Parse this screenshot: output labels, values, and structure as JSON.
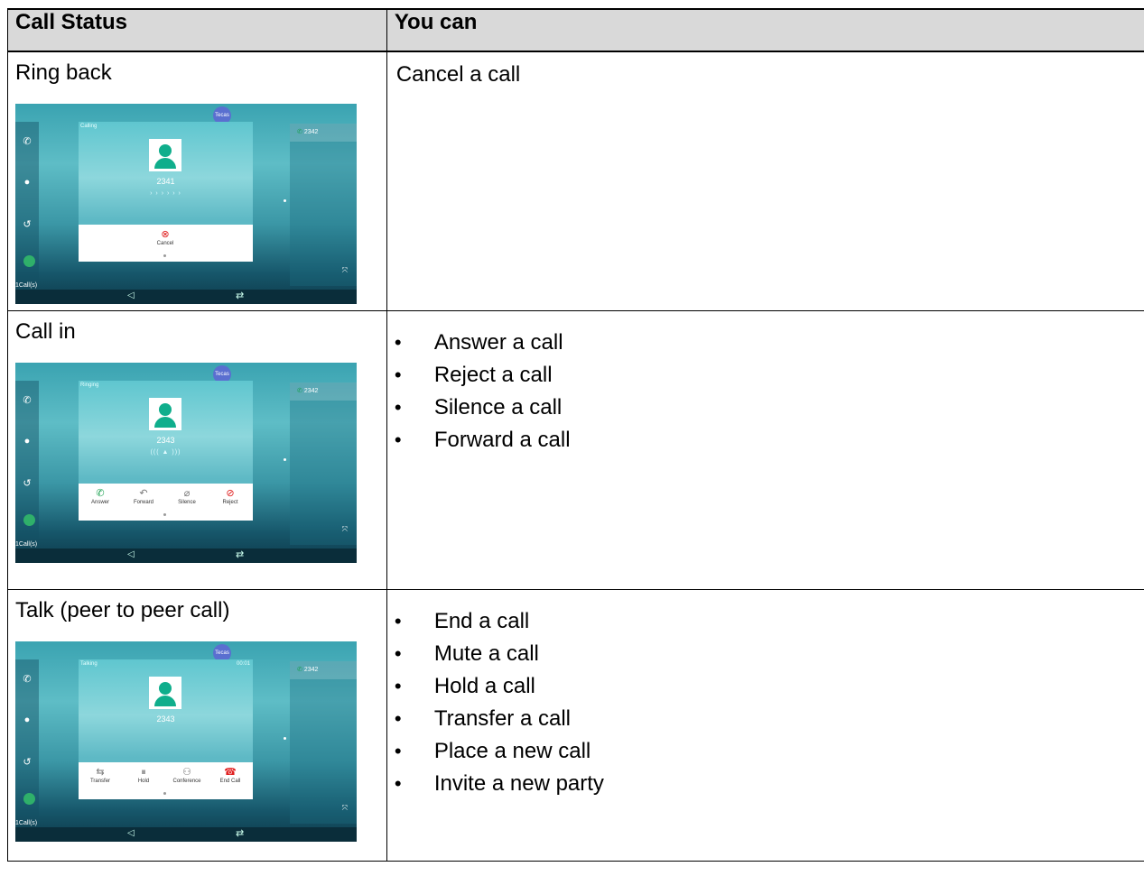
{
  "header": {
    "col1": "Call Status",
    "col2": "You can"
  },
  "rows": [
    {
      "status": "Ring back",
      "action": "Cancel a call",
      "phone": {
        "avatar": "Tecas",
        "state": "Calling",
        "time": "",
        "number": "2341",
        "anim": "› › › › › ›",
        "right_entry": "2342",
        "calls": "1Call(s)",
        "softkeys": [
          {
            "label": "Cancel",
            "icon": "cancel-icon"
          }
        ]
      }
    },
    {
      "status": "Call in",
      "actions": [
        "Answer a call",
        "Reject a call",
        "Silence a call",
        "Forward a call"
      ],
      "phone": {
        "avatar": "Tecas",
        "state": "Ringing",
        "time": "",
        "number": "2343",
        "anim": "((( ▲ )))",
        "right_entry": "2342",
        "calls": "1Call(s)",
        "softkeys": [
          {
            "label": "Answer",
            "icon": "answer-icon"
          },
          {
            "label": "Forward",
            "icon": "forward-icon"
          },
          {
            "label": "Silence",
            "icon": "silence-icon"
          },
          {
            "label": "Reject",
            "icon": "reject-icon"
          }
        ]
      }
    },
    {
      "status": "Talk (peer to peer call)",
      "actions": [
        "End a call",
        "Mute a call",
        "Hold a call",
        "Transfer a call",
        "Place a new call",
        "Invite a new party"
      ],
      "phone": {
        "avatar": "Tecas",
        "state": "Talking",
        "time": "00:01",
        "number": "2343",
        "anim": "",
        "right_entry": "2342",
        "calls": "1Call(s)",
        "softkeys": [
          {
            "label": "Transfer",
            "icon": "transfer-icon"
          },
          {
            "label": "Hold",
            "icon": "hold-icon"
          },
          {
            "label": "Conference",
            "icon": "conference-icon"
          },
          {
            "label": "End Call",
            "icon": "end-call-icon"
          }
        ]
      }
    }
  ]
}
